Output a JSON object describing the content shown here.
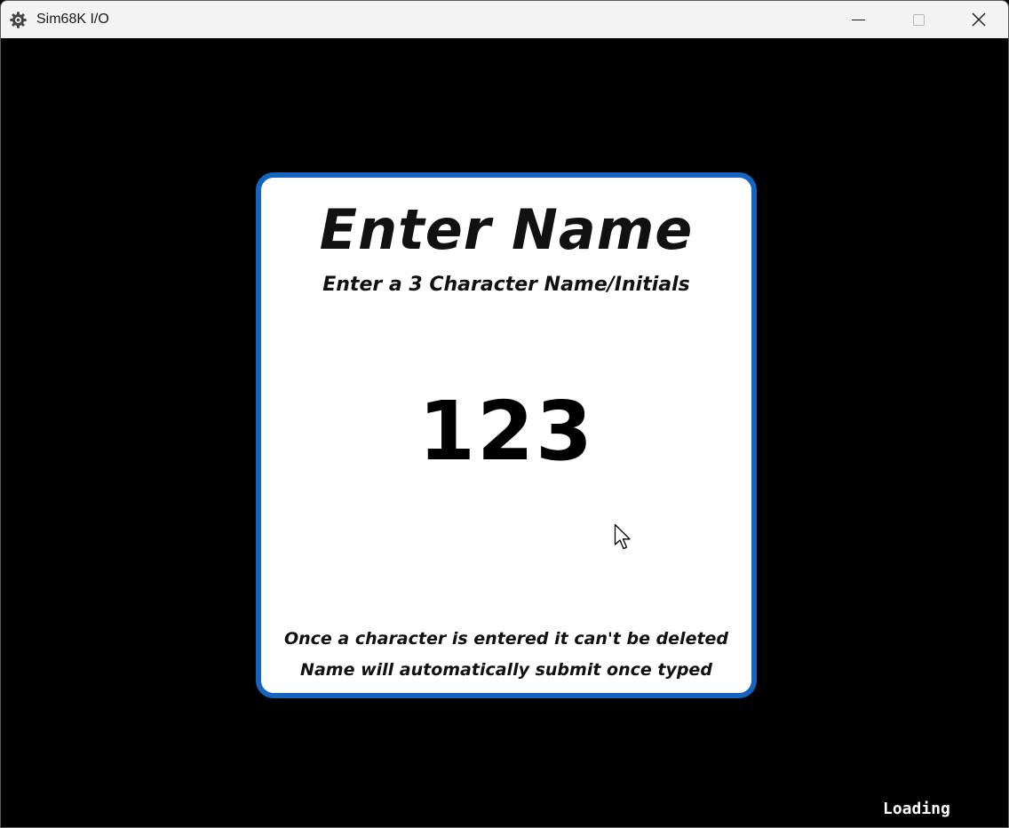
{
  "window": {
    "title": "Sim68K I/O",
    "app_icon": "gear-icon",
    "controls": {
      "minimize_icon": "minimize-icon",
      "maximize_icon": "maximize-icon",
      "close_icon": "close-icon"
    }
  },
  "dialog": {
    "title": "Enter Name",
    "subtitle": "Enter a 3 Character Name/Initials",
    "entered_name": "123",
    "note_line_1": "Once a character is entered it can't be deleted",
    "note_line_2": "Name will automatically submit once typed",
    "border_color": "#1565c0"
  },
  "status": {
    "text": "Loading"
  },
  "mouse": {
    "icon": "mouse-pointer-icon"
  }
}
